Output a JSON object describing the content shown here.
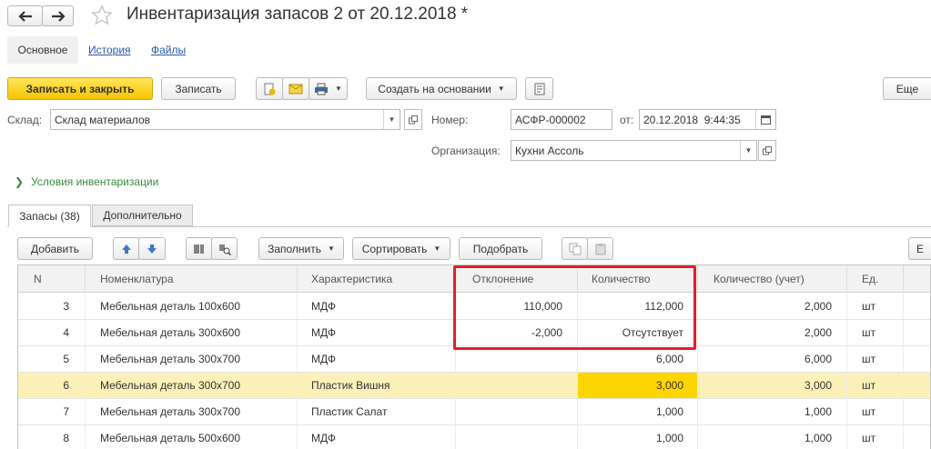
{
  "window": {
    "title": "Инвентаризация запасов 2 от 20.12.2018 *"
  },
  "nav": {
    "back_icon": "arrow-left-icon",
    "forward_icon": "arrow-right-icon",
    "star_icon": "star-icon"
  },
  "tabs_top": [
    {
      "label": "Основное",
      "active": true
    },
    {
      "label": "История",
      "active": false
    },
    {
      "label": "Файлы",
      "active": false
    }
  ],
  "toolbar": {
    "save_close": "Записать и закрыть",
    "save": "Записать",
    "create_based": "Создать на основании",
    "more": "Еще"
  },
  "form": {
    "warehouse_label": "Склад:",
    "warehouse_value": "Склад материалов",
    "number_label": "Номер:",
    "number_value": "АСФР-000002",
    "date_label": "от:",
    "date_value": "20.12.2018  9:44:35",
    "org_label": "Организация:",
    "org_value": "Кухни Ассоль",
    "conditions": "Условия инвентаризации"
  },
  "tabs_inner": [
    {
      "label": "Запасы (38)",
      "active": true
    },
    {
      "label": "Дополнительно",
      "active": false
    }
  ],
  "table_toolbar": {
    "add": "Добавить",
    "fill": "Заполнить",
    "sort": "Сортировать",
    "pick": "Подобрать"
  },
  "table": {
    "columns": [
      "N",
      "Номенклатура",
      "Характеристика",
      "Отклонение",
      "Количество",
      "Количество (учет)",
      "Ед."
    ],
    "rows": [
      {
        "n": "3",
        "item": "Мебельная деталь 100х600",
        "char": "МДФ",
        "dev": "110,000",
        "qty": "112,000",
        "acc": "2,000",
        "unit": "шт",
        "selected": false
      },
      {
        "n": "4",
        "item": "Мебельная деталь 300х600",
        "char": "МДФ",
        "dev": "-2,000",
        "qty": "Отсутствует",
        "acc": "2,000",
        "unit": "шт",
        "selected": false
      },
      {
        "n": "5",
        "item": "Мебельная деталь 300х700",
        "char": "МДФ",
        "dev": "",
        "qty": "6,000",
        "acc": "6,000",
        "unit": "шт",
        "selected": false
      },
      {
        "n": "6",
        "item": "Мебельная деталь 300х700",
        "char": "Пластик Вишня",
        "dev": "",
        "qty": "3,000",
        "acc": "3,000",
        "unit": "шт",
        "selected": true
      },
      {
        "n": "7",
        "item": "Мебельная деталь 300х700",
        "char": "Пластик Салат",
        "dev": "",
        "qty": "1,000",
        "acc": "1,000",
        "unit": "шт",
        "selected": false
      },
      {
        "n": "8",
        "item": "Мебельная деталь 500х600",
        "char": "МДФ",
        "dev": "",
        "qty": "1,000",
        "acc": "1,000",
        "unit": "шт",
        "selected": false
      }
    ]
  },
  "colors": {
    "accent": "#f6c400",
    "selected_row": "#fbf1b8",
    "active_cell": "#ffd500",
    "highlight": "#e0202c",
    "link": "#2a5aa8",
    "green": "#3a8a3a"
  }
}
